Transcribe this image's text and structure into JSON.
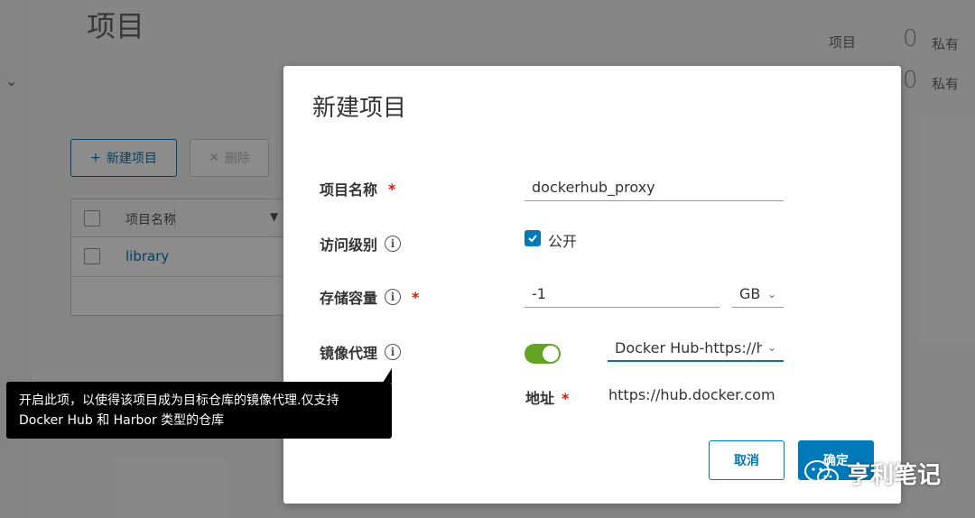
{
  "background": {
    "page_title": "项目",
    "stats": [
      {
        "label": "项目",
        "count": "0",
        "suffix": "私有"
      },
      {
        "label": "",
        "count": "0",
        "suffix": "私有"
      }
    ],
    "toolbar": {
      "new_project": "新建项目",
      "delete": "删除"
    },
    "table": {
      "col_name": "项目名称",
      "rows": [
        "library"
      ]
    }
  },
  "modal": {
    "title": "新建项目",
    "fields": {
      "name_label": "项目名称",
      "name_value": "dockerhub_proxy",
      "access_label": "访问级别",
      "public_label": "公开",
      "storage_label": "存储容量",
      "storage_value": "-1",
      "storage_unit": "GB",
      "proxy_label": "镜像代理",
      "proxy_endpoint": "Docker Hub-https://hu",
      "address_label": "地址",
      "address_value": "https://hub.docker.com"
    },
    "required_mark": "*",
    "cancel": "取消",
    "ok": "确定"
  },
  "tooltip": {
    "line1": "开启此项，以使得该项目成为目标仓库的镜像代理.仅支持",
    "line2": "Docker Hub 和 Harbor 类型的仓库"
  },
  "watermark": "亨利笔记",
  "colors": {
    "primary": "#0079b8",
    "toggle_on": "#62a420",
    "required": "#c92100"
  }
}
